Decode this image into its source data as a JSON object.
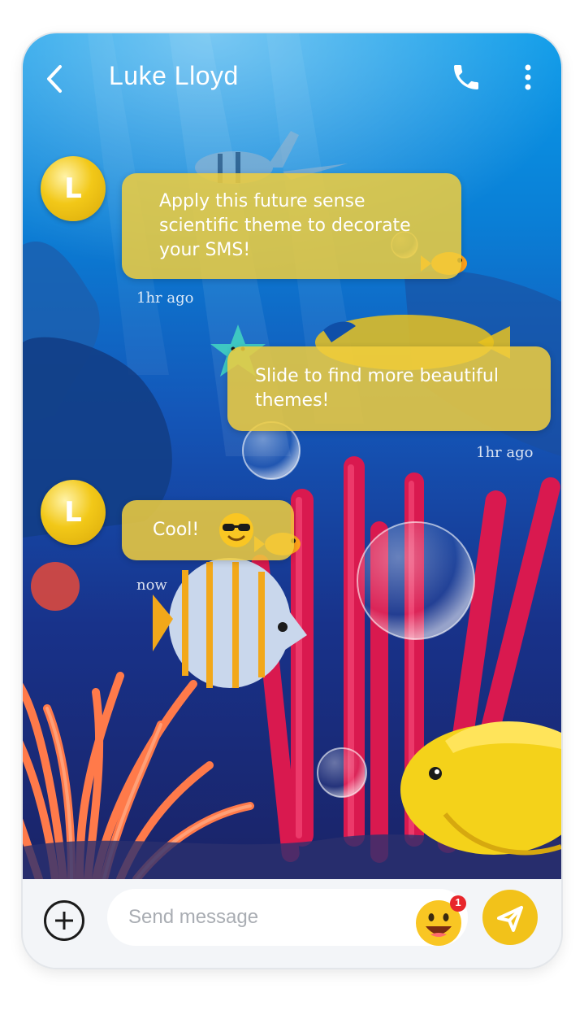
{
  "header": {
    "contact_name": "Luke Lloyd"
  },
  "messages": [
    {
      "avatar_letter": "L",
      "text_lines": [
        "Apply this future sense",
        "scientific theme to decorate",
        "your SMS!"
      ],
      "time": "1hr ago"
    },
    {
      "text_lines": [
        "Slide to find more beautiful",
        "themes!"
      ],
      "time": "1hr ago"
    },
    {
      "avatar_letter": "L",
      "text": "Cool!",
      "time": "now"
    }
  ],
  "composer": {
    "placeholder": "Send message",
    "notification_count": "1"
  },
  "colors": {
    "bubble": "#f0cd3c",
    "send_button": "#f2c21a",
    "ocean_top": "#0b9be9",
    "ocean_bottom": "#1a2367"
  },
  "icons": [
    "back-arrow-icon",
    "phone-icon",
    "more-vertical-icon",
    "plus-icon",
    "emoji-icon",
    "send-icon"
  ]
}
